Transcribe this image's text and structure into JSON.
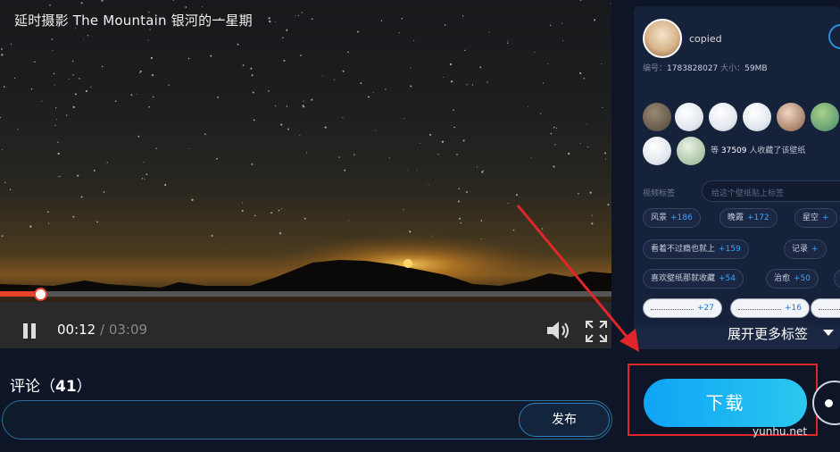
{
  "video": {
    "title": "延时摄影 The Mountain 银河的一星期",
    "current_time": "00:12",
    "total_time": " / 03:09",
    "progress": 0.065
  },
  "comments": {
    "label": "评论（",
    "count": "41",
    "label_end": "）",
    "publish_label": "发布",
    "input_value": ""
  },
  "panel": {
    "user": {
      "name": "copied",
      "id_label": "编号：",
      "id_value": "1783828027",
      "size_label": "  大小：",
      "size_value": "59MB"
    },
    "likes": {
      "prefix": "等 ",
      "count": "37509",
      "suffix": " 人收藏了该壁纸"
    },
    "tags_label": "视频标签",
    "tag_input_placeholder": "给这个壁纸贴上标签",
    "tags": [
      {
        "name": "风景",
        "count": "+186"
      },
      {
        "name": "晚霞",
        "count": "+172"
      },
      {
        "name": "星空",
        "count": "+"
      },
      {
        "name": "看着不过瘾也就上",
        "count": "+159"
      },
      {
        "name": "记录",
        "count": "+"
      },
      {
        "name": "喜欢壁纸那就收藏",
        "count": "+54"
      },
      {
        "name": "治愈",
        "count": "+50"
      },
      {
        "name": "",
        "count": ""
      },
      {
        "name": "",
        "count": "+27"
      },
      {
        "name": "",
        "count": "+16"
      },
      {
        "name": "",
        "count": ""
      }
    ],
    "expand_label": "展开更多标签"
  },
  "download": {
    "label": "下载"
  },
  "watermark": "yunhu.net"
}
